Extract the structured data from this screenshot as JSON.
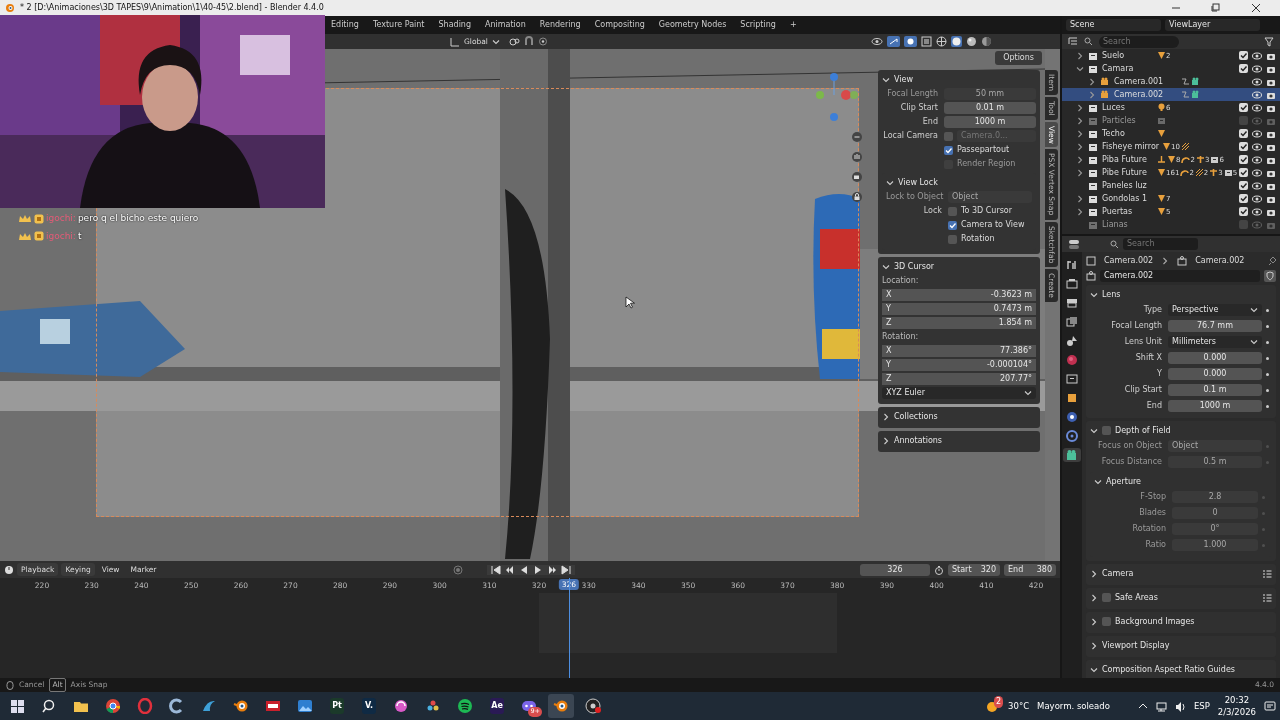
{
  "window": {
    "title": "* 2 [D:\\Animaciones\\3D TAPES\\9\\Animation\\1\\40-45\\2.blend] - Blender 4.4.0"
  },
  "workspace_tabs": [
    {
      "label": "Editing",
      "selected": false
    },
    {
      "label": "Texture Paint",
      "selected": false
    },
    {
      "label": "Shading",
      "selected": false
    },
    {
      "label": "Animation",
      "selected": false
    },
    {
      "label": "Rendering",
      "selected": false
    },
    {
      "label": "Compositing",
      "selected": false
    },
    {
      "label": "Geometry Nodes",
      "selected": false
    },
    {
      "label": "Scripting",
      "selected": false
    }
  ],
  "add_workspace": "+",
  "scene": {
    "scene": "Scene",
    "view_layer": "ViewLayer"
  },
  "viewport_header": {
    "orientation": "Global",
    "options": "Options"
  },
  "chat": [
    {
      "user": "igochi:",
      "message": "pero q el bicho este quiero"
    },
    {
      "user": "igochi:",
      "message": "t"
    }
  ],
  "sidebar_tabs": [
    {
      "label": "Item",
      "selected": false
    },
    {
      "label": "Tool",
      "selected": false
    },
    {
      "label": "View",
      "selected": true
    },
    {
      "label": "PSX Vertex Snap",
      "selected": false
    },
    {
      "label": "Sketchfab",
      "selected": false
    },
    {
      "label": "Create",
      "selected": false
    }
  ],
  "n_panel": [
    {
      "title": "View",
      "expanded": true,
      "rows": [
        {
          "kind": "number",
          "label": "Focal Length",
          "value": "50 mm",
          "disabled": true
        },
        {
          "kind": "number",
          "label": "Clip Start",
          "value": "0.01 m",
          "disabled": false
        },
        {
          "kind": "number",
          "label": "End",
          "value": "1000 m",
          "disabled": false
        },
        {
          "kind": "checkbox_object",
          "label": "Local Camera",
          "checked": false,
          "value": "Camera.0..."
        },
        {
          "kind": "checkbox",
          "text": "Passepartout",
          "checked": true,
          "disabled": false
        },
        {
          "kind": "checkbox",
          "text": "Render Region",
          "checked": false,
          "disabled": true
        }
      ],
      "subsections": [
        {
          "title": "View Lock",
          "expanded": true,
          "rows": [
            {
              "kind": "object",
              "label": "Lock to Object",
              "placeholder": "Object",
              "disabled": true
            },
            {
              "kind": "checkbox",
              "label": "Lock",
              "text": "To 3D Cursor",
              "checked": false,
              "disabled": false
            },
            {
              "kind": "checkbox",
              "text": "Camera to View",
              "checked": true,
              "disabled": false
            },
            {
              "kind": "checkbox",
              "text": "Rotation",
              "checked": false,
              "disabled": false
            }
          ]
        }
      ]
    },
    {
      "title": "3D Cursor",
      "expanded": true,
      "rows": [
        {
          "kind": "caption",
          "text": "Location:"
        },
        {
          "kind": "vector",
          "label": "X",
          "value": "-0.3623 m"
        },
        {
          "kind": "vector",
          "label": "Y",
          "value": "0.7473 m"
        },
        {
          "kind": "vector",
          "label": "Z",
          "value": "1.854 m"
        },
        {
          "kind": "caption",
          "text": "Rotation:"
        },
        {
          "kind": "vector",
          "label": "X",
          "value": "77.386°"
        },
        {
          "kind": "vector",
          "label": "Y",
          "value": "-0.000104°"
        },
        {
          "kind": "vector",
          "label": "Z",
          "value": "207.77°"
        },
        {
          "kind": "dropdown",
          "value": "XYZ Euler"
        }
      ]
    },
    {
      "title": "Collections",
      "expanded": false
    },
    {
      "title": "Annotations",
      "expanded": false
    }
  ],
  "outliner": {
    "search_placeholder": "Search",
    "items": [
      {
        "name": "Suelo",
        "kind": "collection",
        "expanded": false,
        "checked": true,
        "disabled": false,
        "selected": false,
        "badges": [
          {
            "kind": "mesh",
            "count": "2"
          }
        ]
      },
      {
        "name": "Camara",
        "kind": "collection",
        "expanded": true,
        "checked": true,
        "disabled": false,
        "selected": false,
        "children": [
          {
            "name": "Camera.001",
            "kind": "camera",
            "expanded": false,
            "disabled": false,
            "selected": false,
            "badges": [
              {
                "kind": "constraint"
              },
              {
                "kind": "cameradata"
              }
            ]
          },
          {
            "name": "Camera.002",
            "kind": "camera",
            "expanded": false,
            "disabled": false,
            "selected": true,
            "badges": [
              {
                "kind": "constraint"
              },
              {
                "kind": "cameradata"
              }
            ]
          }
        ]
      },
      {
        "name": "Luces",
        "kind": "collection",
        "expanded": false,
        "checked": true,
        "disabled": false,
        "selected": false,
        "badges": [
          {
            "kind": "light",
            "count": "6"
          }
        ]
      },
      {
        "name": "Particles",
        "kind": "collection",
        "expanded": false,
        "checked": false,
        "disabled": true,
        "selected": false,
        "badges": [
          {
            "kind": "collection"
          }
        ]
      },
      {
        "name": "Techo",
        "kind": "collection",
        "expanded": false,
        "checked": true,
        "disabled": false,
        "selected": false,
        "badges": [
          {
            "kind": "mesh"
          }
        ]
      },
      {
        "name": "Fisheye mirror",
        "kind": "collection",
        "expanded": false,
        "checked": true,
        "disabled": false,
        "selected": false,
        "badges": [
          {
            "kind": "mesh",
            "count": "10"
          },
          {
            "kind": "hair"
          }
        ]
      },
      {
        "name": "Piba Future",
        "kind": "collection",
        "expanded": false,
        "checked": true,
        "disabled": false,
        "selected": false,
        "badges": [
          {
            "kind": "empty"
          },
          {
            "kind": "mesh",
            "count": "8"
          },
          {
            "kind": "curve",
            "count": "2"
          },
          {
            "kind": "armature",
            "count": "3"
          },
          {
            "kind": "collection",
            "count": "6"
          }
        ]
      },
      {
        "name": "Pibe Future",
        "kind": "collection",
        "expanded": false,
        "checked": true,
        "disabled": false,
        "selected": false,
        "badges": [
          {
            "kind": "mesh",
            "count": "161"
          },
          {
            "kind": "curve",
            "count": "2"
          },
          {
            "kind": "hair",
            "count": "2"
          },
          {
            "kind": "armature",
            "count": "3"
          },
          {
            "kind": "collection",
            "count": "5"
          }
        ]
      },
      {
        "name": "Paneles luz",
        "kind": "collection",
        "checked": true,
        "disabled": false,
        "selected": false
      },
      {
        "name": "Gondolas 1",
        "kind": "collection",
        "expanded": false,
        "checked": true,
        "disabled": false,
        "selected": false,
        "badges": [
          {
            "kind": "mesh",
            "count": "7"
          }
        ]
      },
      {
        "name": "Puertas",
        "kind": "collection",
        "expanded": false,
        "checked": true,
        "disabled": false,
        "selected": false,
        "badges": [
          {
            "kind": "mesh",
            "count": "5"
          }
        ]
      },
      {
        "name": "Lianas",
        "kind": "collection",
        "checked": false,
        "disabled": true,
        "selected": false
      }
    ]
  },
  "properties": {
    "search_placeholder": "Search",
    "tabs": [
      {
        "kind": "tool",
        "selected": false
      },
      {
        "kind": "render",
        "selected": false
      },
      {
        "kind": "output",
        "selected": false
      },
      {
        "kind": "viewlayer",
        "selected": false
      },
      {
        "kind": "scene",
        "selected": false
      },
      {
        "kind": "world",
        "selected": false
      },
      {
        "kind": "collection",
        "selected": false
      },
      {
        "kind": "object",
        "selected": false
      },
      {
        "kind": "physics",
        "selected": false
      },
      {
        "kind": "constraint",
        "selected": false
      },
      {
        "kind": "camera",
        "selected": true
      }
    ],
    "breadcrumb": [
      "Camera.002",
      "Camera.002"
    ],
    "datablock": "Camera.002",
    "sections": [
      {
        "title": "Lens",
        "expanded": true,
        "rows": [
          {
            "kind": "dropdown",
            "label": "Type",
            "value": "Perspective"
          },
          {
            "kind": "number",
            "label": "Focal Length",
            "value": "76.7 mm",
            "disabled": false
          },
          {
            "kind": "dropdown",
            "label": "Lens Unit",
            "value": "Millimeters"
          },
          {
            "kind": "number",
            "label": "Shift X",
            "value": "0.000",
            "disabled": false
          },
          {
            "kind": "number",
            "label": "Y",
            "value": "0.000",
            "disabled": false
          },
          {
            "kind": "number",
            "label": "Clip Start",
            "value": "0.1 m",
            "disabled": false
          },
          {
            "kind": "number",
            "label": "End",
            "value": "1000 m",
            "disabled": false
          }
        ]
      },
      {
        "title": "Depth of Field",
        "expanded": true,
        "checkbox": false,
        "rows": [
          {
            "kind": "object",
            "label": "Focus on Object",
            "placeholder": "Object",
            "disabled": true
          },
          {
            "kind": "number",
            "label": "Focus Distance",
            "value": "0.5 m",
            "disabled": true
          }
        ],
        "subsections": [
          {
            "title": "Aperture",
            "expanded": true,
            "rows": [
              {
                "kind": "number",
                "label": "F-Stop",
                "value": "2.8",
                "disabled": true
              },
              {
                "kind": "number",
                "label": "Blades",
                "value": "0",
                "disabled": true
              },
              {
                "kind": "number",
                "label": "Rotation",
                "value": "0°",
                "disabled": true
              },
              {
                "kind": "number",
                "label": "Ratio",
                "value": "1.000",
                "disabled": true
              }
            ]
          }
        ]
      },
      {
        "title": "Camera",
        "expanded": false,
        "presets": true
      },
      {
        "title": "Safe Areas",
        "expanded": false,
        "checkbox": false,
        "presets": true
      },
      {
        "title": "Background Images",
        "expanded": false,
        "checkbox": false
      },
      {
        "title": "Viewport Display",
        "expanded": false
      },
      {
        "title": "Composition Aspect Ratio Guides",
        "expanded": true
      }
    ]
  },
  "timeline": {
    "menus": [
      "Playback",
      "Keying",
      "View",
      "Marker"
    ],
    "current_frame": "326",
    "start_label": "Start",
    "start": "320",
    "end_label": "End",
    "end": "380",
    "ruler": [
      "220",
      "230",
      "240",
      "250",
      "260",
      "270",
      "280",
      "290",
      "300",
      "310",
      "320",
      "330",
      "340",
      "350",
      "360",
      "370",
      "380",
      "390",
      "400",
      "410",
      "420"
    ],
    "playhead": {
      "label": "326",
      "level": 0.53
    }
  },
  "status_bar": {
    "hints": [
      {
        "text": "Cancel"
      },
      {
        "key": "Alt",
        "text": "Axis Snap"
      }
    ],
    "version": "4.4.0"
  },
  "taskbar": {
    "apps": [
      {
        "kind": "folder",
        "active": false
      },
      {
        "kind": "chrome",
        "active": false
      },
      {
        "kind": "opera",
        "active": false
      },
      {
        "kind": "c-app",
        "active": false
      },
      {
        "kind": "fan",
        "active": false
      },
      {
        "kind": "blender",
        "active": false
      },
      {
        "kind": "red-tile",
        "active": false
      },
      {
        "kind": "photos",
        "active": false
      },
      {
        "kind": "tile",
        "label": "Pt",
        "color": "#1b3a2a",
        "active": false
      },
      {
        "kind": "tile",
        "label": "V.",
        "color": "#0f2a44",
        "active": false
      },
      {
        "kind": "swirl",
        "active": false
      },
      {
        "kind": "resolve",
        "active": false
      },
      {
        "kind": "spotify",
        "active": false
      },
      {
        "kind": "tile",
        "label": "Ae",
        "color": "#2a1a55",
        "active": false
      },
      {
        "kind": "discord",
        "badge": "9+",
        "active": false
      },
      {
        "kind": "blender",
        "active": true
      },
      {
        "kind": "obs",
        "active": false
      }
    ],
    "weather_badge": "2",
    "temperature": "30°C",
    "weather": "Mayorm. soleado",
    "language": "ESP",
    "time": "20:32",
    "date": "2/3/2026"
  }
}
